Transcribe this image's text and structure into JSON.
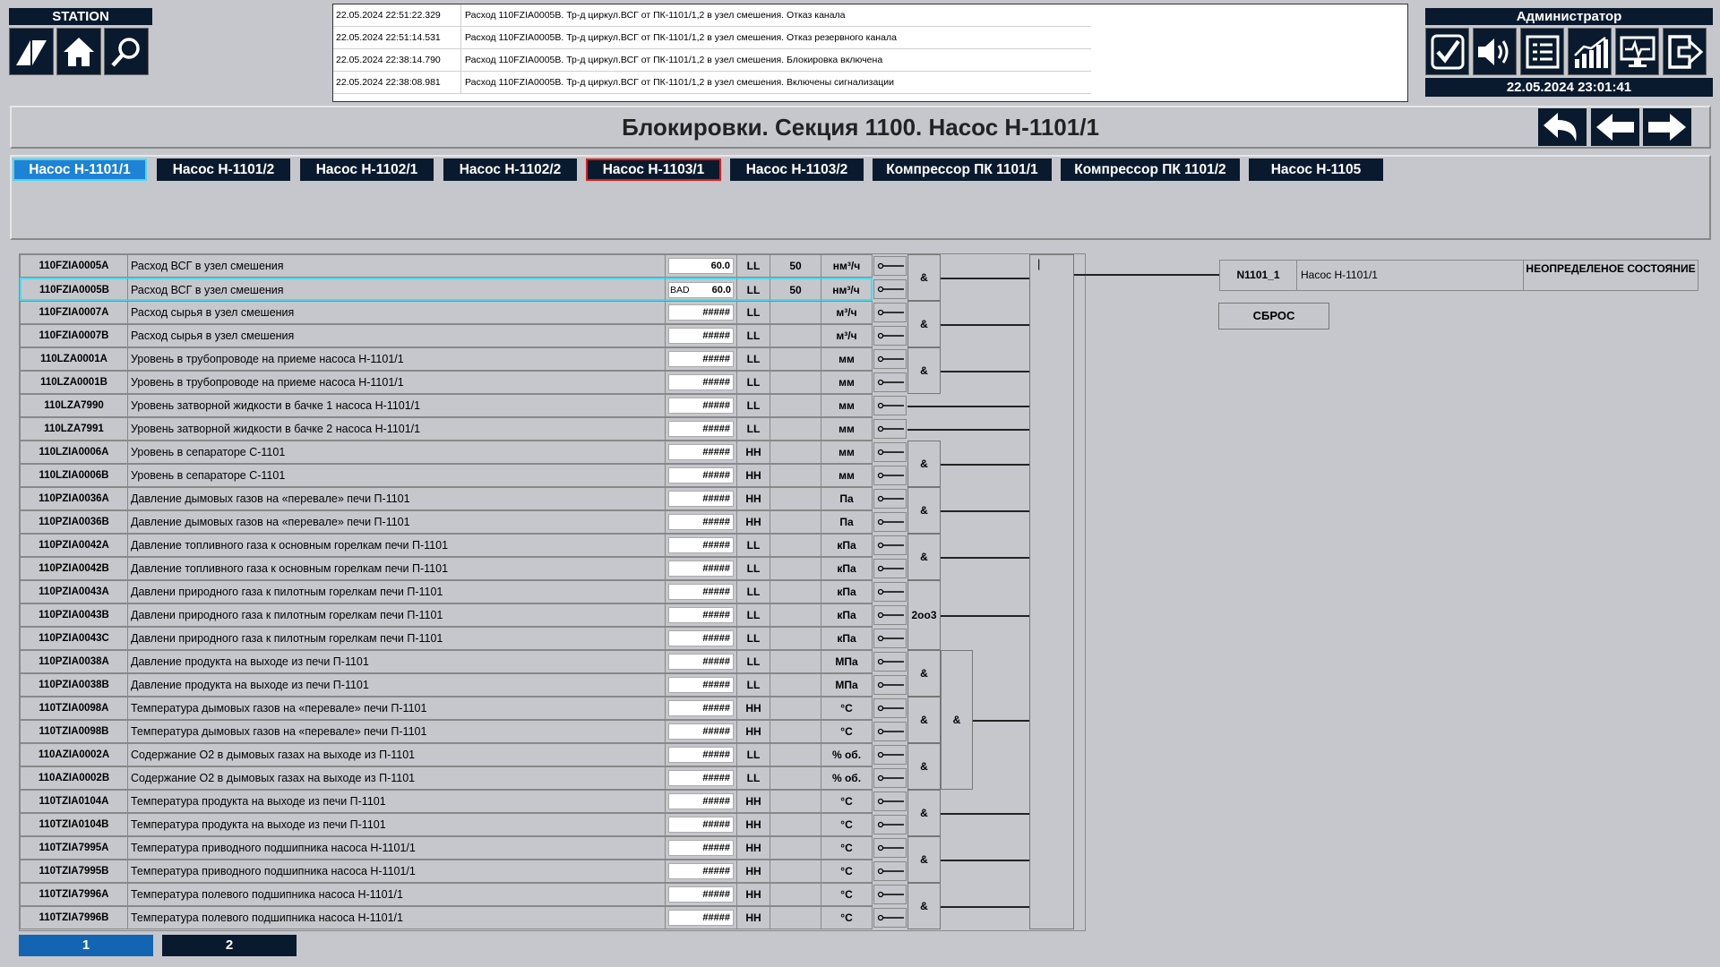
{
  "header": {
    "station_label": "STATION",
    "admin_label": "Администратор",
    "datetime": "22.05.2024 23:01:41"
  },
  "events": [
    {
      "time": "22.05.2024 22:51:22.329",
      "text": "Расход 110FZIA0005B. Тр-д циркул.ВСГ от ПК-1101/1,2 в узел смешения. Отказ канала"
    },
    {
      "time": "22.05.2024 22:51:14.531",
      "text": "Расход 110FZIA0005B. Тр-д циркул.ВСГ от ПК-1101/1,2 в узел смешения. Отказ резервного канала"
    },
    {
      "time": "22.05.2024 22:38:14.790",
      "text": "Расход 110FZIA0005B. Тр-д циркул.ВСГ от ПК-1101/1,2 в узел смешения. Блокировка включена"
    },
    {
      "time": "22.05.2024 22:38:08.981",
      "text": "Расход 110FZIA0005B. Тр-д циркул.ВСГ от ПК-1101/1,2 в узел смешения. Включены сигнализации"
    }
  ],
  "title": "Блокировки. Секция 1100. Насос Н-1101/1",
  "tabs": [
    "Насос Н-1101/1",
    "Насос Н-1101/2",
    "Насос Н-1102/1",
    "Насос Н-1102/2",
    "Насос Н-1103/1",
    "Насос Н-1103/2",
    "Компрессор ПК 1101/1",
    "Компрессор ПК 1101/2",
    "Насос Н-1105"
  ],
  "rows": [
    {
      "tag": "110FZIA0005A",
      "desc": "Расход ВСГ в узел смешения",
      "bad": "",
      "value": "60.0",
      "limit": "LL",
      "setpoint": "50",
      "unit": "нм³/ч"
    },
    {
      "tag": "110FZIA0005B",
      "desc": "Расход ВСГ в узел смешения",
      "bad": "BAD",
      "value": "60.0",
      "limit": "LL",
      "setpoint": "50",
      "unit": "нм³/ч"
    },
    {
      "tag": "110FZIA0007A",
      "desc": "Расход сырья в узел смешения",
      "bad": "",
      "value": "#####",
      "limit": "LL",
      "setpoint": "",
      "unit": "м³/ч"
    },
    {
      "tag": "110FZIA0007B",
      "desc": "Расход сырья в узел смешения",
      "bad": "",
      "value": "#####",
      "limit": "LL",
      "setpoint": "",
      "unit": "м³/ч"
    },
    {
      "tag": "110LZA0001A",
      "desc": "Уровень в трубопроводе на приеме насоса Н-1101/1",
      "bad": "",
      "value": "#####",
      "limit": "LL",
      "setpoint": "",
      "unit": "мм"
    },
    {
      "tag": "110LZA0001B",
      "desc": "Уровень в трубопроводе на приеме насоса Н-1101/1",
      "bad": "",
      "value": "#####",
      "limit": "LL",
      "setpoint": "",
      "unit": "мм"
    },
    {
      "tag": "110LZA7990",
      "desc": "Уровень затворной жидкости в бачке 1 насоса Н-1101/1",
      "bad": "",
      "value": "#####",
      "limit": "LL",
      "setpoint": "",
      "unit": "мм"
    },
    {
      "tag": "110LZA7991",
      "desc": "Уровень затворной жидкости в бачке 2 насоса Н-1101/1",
      "bad": "",
      "value": "#####",
      "limit": "LL",
      "setpoint": "",
      "unit": "мм"
    },
    {
      "tag": "110LZIA0006A",
      "desc": "Уровень в сепараторе С-1101",
      "bad": "",
      "value": "#####",
      "limit": "HH",
      "setpoint": "",
      "unit": "мм"
    },
    {
      "tag": "110LZIA0006B",
      "desc": "Уровень в сепараторе С-1101",
      "bad": "",
      "value": "#####",
      "limit": "HH",
      "setpoint": "",
      "unit": "мм"
    },
    {
      "tag": "110PZIA0036A",
      "desc": "Давление дымовых газов на «перевале» печи П-1101",
      "bad": "",
      "value": "#####",
      "limit": "HH",
      "setpoint": "",
      "unit": "Па"
    },
    {
      "tag": "110PZIA0036B",
      "desc": "Давление дымовых газов на «перевале» печи П-1101",
      "bad": "",
      "value": "#####",
      "limit": "HH",
      "setpoint": "",
      "unit": "Па"
    },
    {
      "tag": "110PZIA0042A",
      "desc": "Давление топливного газа к основным горелкам печи П-1101",
      "bad": "",
      "value": "#####",
      "limit": "LL",
      "setpoint": "",
      "unit": "кПа"
    },
    {
      "tag": "110PZIA0042B",
      "desc": "Давление топливного газа к основным горелкам печи П-1101",
      "bad": "",
      "value": "#####",
      "limit": "LL",
      "setpoint": "",
      "unit": "кПа"
    },
    {
      "tag": "110PZIA0043A",
      "desc": "Давлени природного газа к пилотным горелкам печи П-1101",
      "bad": "",
      "value": "#####",
      "limit": "LL",
      "setpoint": "",
      "unit": "кПа"
    },
    {
      "tag": "110PZIA0043B",
      "desc": "Давлени природного газа к пилотным горелкам печи П-1101",
      "bad": "",
      "value": "#####",
      "limit": "LL",
      "setpoint": "",
      "unit": "кПа"
    },
    {
      "tag": "110PZIA0043C",
      "desc": "Давлени природного газа к пилотным горелкам печи П-1101",
      "bad": "",
      "value": "#####",
      "limit": "LL",
      "setpoint": "",
      "unit": "кПа"
    },
    {
      "tag": "110PZIA0038A",
      "desc": "Давление продукта на выходе из печи П-1101",
      "bad": "",
      "value": "#####",
      "limit": "LL",
      "setpoint": "",
      "unit": "МПа"
    },
    {
      "tag": "110PZIA0038B",
      "desc": "Давление продукта на выходе из печи П-1101",
      "bad": "",
      "value": "#####",
      "limit": "LL",
      "setpoint": "",
      "unit": "МПа"
    },
    {
      "tag": "110TZIA0098A",
      "desc": "Температура дымовых газов на «перевале» печи П-1101",
      "bad": "",
      "value": "#####",
      "limit": "HH",
      "setpoint": "",
      "unit": "°C"
    },
    {
      "tag": "110TZIA0098B",
      "desc": "Температура дымовых газов на «перевале» печи П-1101",
      "bad": "",
      "value": "#####",
      "limit": "HH",
      "setpoint": "",
      "unit": "°C"
    },
    {
      "tag": "110AZIA0002A",
      "desc": "Содержание О2 в дымовых газах на выходе из П-1101",
      "bad": "",
      "value": "#####",
      "limit": "LL",
      "setpoint": "",
      "unit": "% об."
    },
    {
      "tag": "110AZIA0002B",
      "desc": "Содержание О2 в дымовых газах на выходе из П-1101",
      "bad": "",
      "value": "#####",
      "limit": "LL",
      "setpoint": "",
      "unit": "% об."
    },
    {
      "tag": "110TZIA0104A",
      "desc": "Температура продукта на выходе из печи П-1101",
      "bad": "",
      "value": "#####",
      "limit": "HH",
      "setpoint": "",
      "unit": "°C"
    },
    {
      "tag": "110TZIA0104B",
      "desc": "Температура продукта на выходе из печи П-1101",
      "bad": "",
      "value": "#####",
      "limit": "HH",
      "setpoint": "",
      "unit": "°C"
    },
    {
      "tag": "110TZIA7995A",
      "desc": "Температура приводного подшипника насоса Н-1101/1",
      "bad": "",
      "value": "#####",
      "limit": "HH",
      "setpoint": "",
      "unit": "°C"
    },
    {
      "tag": "110TZIA7995B",
      "desc": "Температура приводного подшипника насоса Н-1101/1",
      "bad": "",
      "value": "#####",
      "limit": "HH",
      "setpoint": "",
      "unit": "°C"
    },
    {
      "tag": "110TZIA7996A",
      "desc": "Температура полевого подшипника насоса Н-1101/1",
      "bad": "",
      "value": "#####",
      "limit": "HH",
      "setpoint": "",
      "unit": "°C"
    },
    {
      "tag": "110TZIA7996B",
      "desc": "Температура полевого подшипника насоса Н-1101/1",
      "bad": "",
      "value": "#####",
      "limit": "HH",
      "setpoint": "",
      "unit": "°C"
    }
  ],
  "logic": {
    "and": "&",
    "two_of_three": "2oo3"
  },
  "info": {
    "id": "N1101_1",
    "name": "Насос Н-1101/1",
    "state": "НЕОПРЕДЕЛЕНОЕ СОСТОЯНИЕ",
    "reset_label": "СБРОС",
    "bus_cursor": "|"
  },
  "pages": [
    "1",
    "2"
  ]
}
